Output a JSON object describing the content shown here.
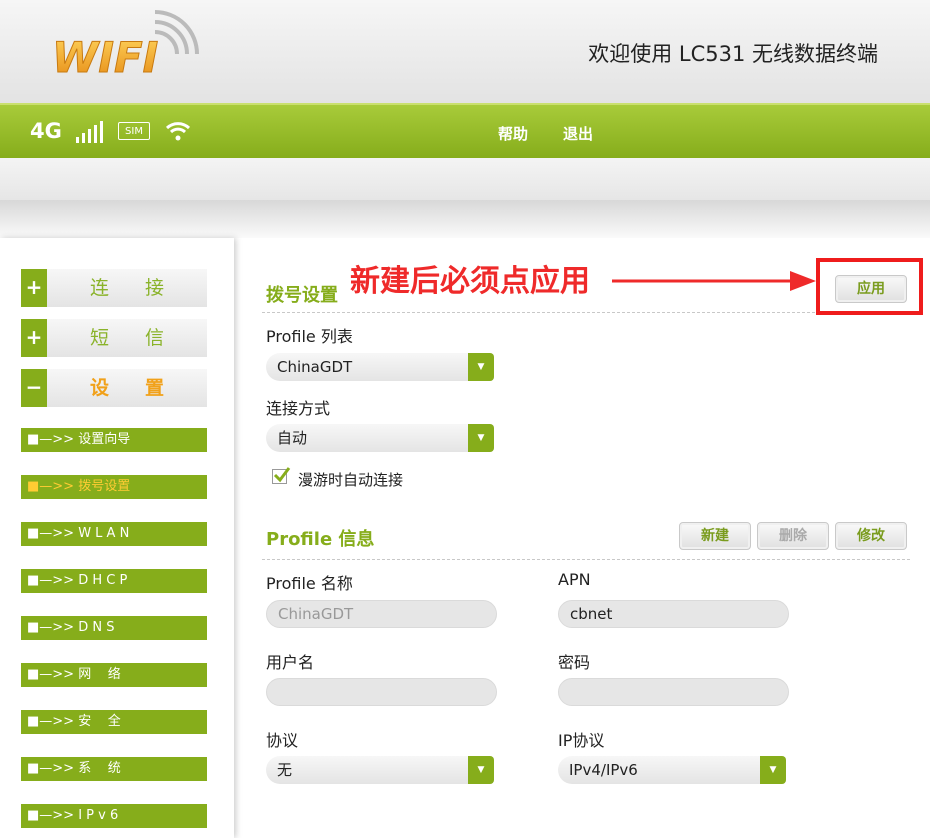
{
  "header": {
    "logo_text": "WIFI",
    "welcome": "欢迎使用 LC531 无线数据终端"
  },
  "statusbar": {
    "network": "4G",
    "sim": "SIM",
    "help": "帮助",
    "logout": "退出"
  },
  "sidebar": {
    "main_items": [
      {
        "sign": "+",
        "label": "连接"
      },
      {
        "sign": "+",
        "label": "短信"
      },
      {
        "sign": "−",
        "label": "设置"
      }
    ],
    "sub_items": [
      {
        "label": "■—>> 设置向导"
      },
      {
        "label": "■—>> 拨号设置"
      },
      {
        "label": "■—>> W L A N"
      },
      {
        "label": "■—>> D H C P"
      },
      {
        "label": "■—>> D N S"
      },
      {
        "label": "■—>> 网    络"
      },
      {
        "label": "■—>> 安    全"
      },
      {
        "label": "■—>> 系    统"
      },
      {
        "label": "■—>> I P v 6"
      }
    ]
  },
  "dial": {
    "title": "拨号设置",
    "apply": "应用",
    "profile_list_label": "Profile 列表",
    "profile_list_value": "ChinaGDT",
    "connect_mode_label": "连接方式",
    "connect_mode_value": "自动",
    "roaming_label": "漫游时自动连接"
  },
  "annotation": "新建后必须点应用",
  "profile_info": {
    "title": "Profile 信息",
    "new": "新建",
    "delete": "删除",
    "modify": "修改",
    "name_label": "Profile 名称",
    "name_value": "ChinaGDT",
    "apn_label": "APN",
    "apn_value": "cbnet",
    "user_label": "用户名",
    "user_value": "",
    "password_label": "密码",
    "password_value": "",
    "protocol_label": "协议",
    "protocol_value": "无",
    "ip_protocol_label": "IP协议",
    "ip_protocol_value": "IPv4/IPv6"
  },
  "colors": {
    "accent": "#86ad1b",
    "active_menu": "#f1a11a",
    "annotation": "#ef2a2a"
  }
}
